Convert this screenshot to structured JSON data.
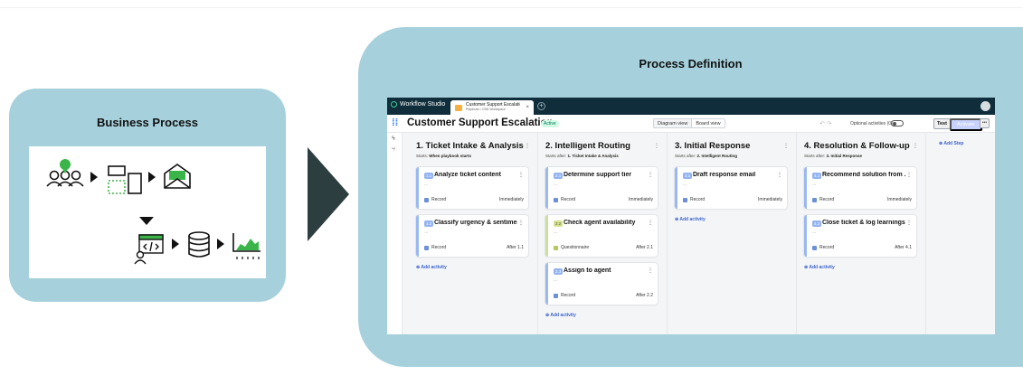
{
  "business_process": {
    "title": "Business Process"
  },
  "process_definition": {
    "title": "Process Definition"
  },
  "app": {
    "brand": "Workflow Studio",
    "tab": {
      "title": "Customer Support Escalatio",
      "subtitle": "Playbook • CSM Workspace",
      "close": "×"
    },
    "tab_add": "+",
    "header": {
      "title": "Customer Support Escalation",
      "badge": "Active",
      "diagram_view": "Diagram view",
      "board_view": "Board view",
      "optional_activities": "Optional activities (0)",
      "test": "Test",
      "publish": "Activate",
      "more": "•••"
    },
    "columns": [
      {
        "title": "1. Ticket Intake & Analysis",
        "starts_label": "Starts:",
        "starts_value": "When playbook starts",
        "cards": [
          {
            "num": "1.1",
            "name": "Analyze ticket content",
            "desc": "...",
            "type": "Record",
            "when": "Immediately"
          },
          {
            "num": "1.2",
            "name": "Classify urgency & sentiment",
            "desc": "...",
            "type": "Record",
            "when": "After 1.1"
          }
        ],
        "add_activity": "⊕ Add activity"
      },
      {
        "title": "2. Intelligent Routing",
        "starts_label": "Starts after:",
        "starts_value": "1. Ticket Intake & Analysis",
        "cards": [
          {
            "num": "2.1",
            "name": "Determine support tier",
            "desc": "...",
            "type": "Record",
            "when": "Immediately"
          },
          {
            "num": "2.2",
            "name": "Check agent availability",
            "desc": "...",
            "type": "Questionnaire",
            "when": "After 2.1"
          },
          {
            "num": "2.3",
            "name": "Assign to agent",
            "desc": "...",
            "type": "Record",
            "when": "After 2.2"
          }
        ],
        "add_activity": "⊕ Add activity"
      },
      {
        "title": "3. Initial Response",
        "starts_label": "Starts after:",
        "starts_value": "2. Intelligent Routing",
        "cards": [
          {
            "num": "3.1",
            "name": "Draft response email",
            "desc": "...",
            "type": "Record",
            "when": "Immediately"
          }
        ],
        "add_activity": "⊕ Add activity"
      },
      {
        "title": "4. Resolution & Follow-up",
        "starts_label": "Starts after:",
        "starts_value": "3. Initial Response",
        "cards": [
          {
            "num": "4.1",
            "name": "Recommend solution from ...",
            "desc": "...",
            "type": "Record",
            "when": "Immediately"
          },
          {
            "num": "4.2",
            "name": "Close ticket & log learnings",
            "desc": "...",
            "type": "Record",
            "when": "After 4.1"
          }
        ],
        "add_activity": "⊕ Add activity"
      }
    ],
    "add_step": "⊕ Add Step"
  },
  "colors": {
    "panel": "#a6d1dc",
    "arrow": "#2d3e40",
    "titlebar": "#0f2d3a",
    "accent_blue": "#93b4f1",
    "accent_green": "#d7e28c"
  },
  "icons": [
    "person-group-icon",
    "chat-bubble-icon",
    "form-layout-icon",
    "email-icon",
    "code-screen-icon",
    "database-icon",
    "analytics-chart-icon",
    "arrow-right-icon",
    "arrow-down-icon"
  ]
}
